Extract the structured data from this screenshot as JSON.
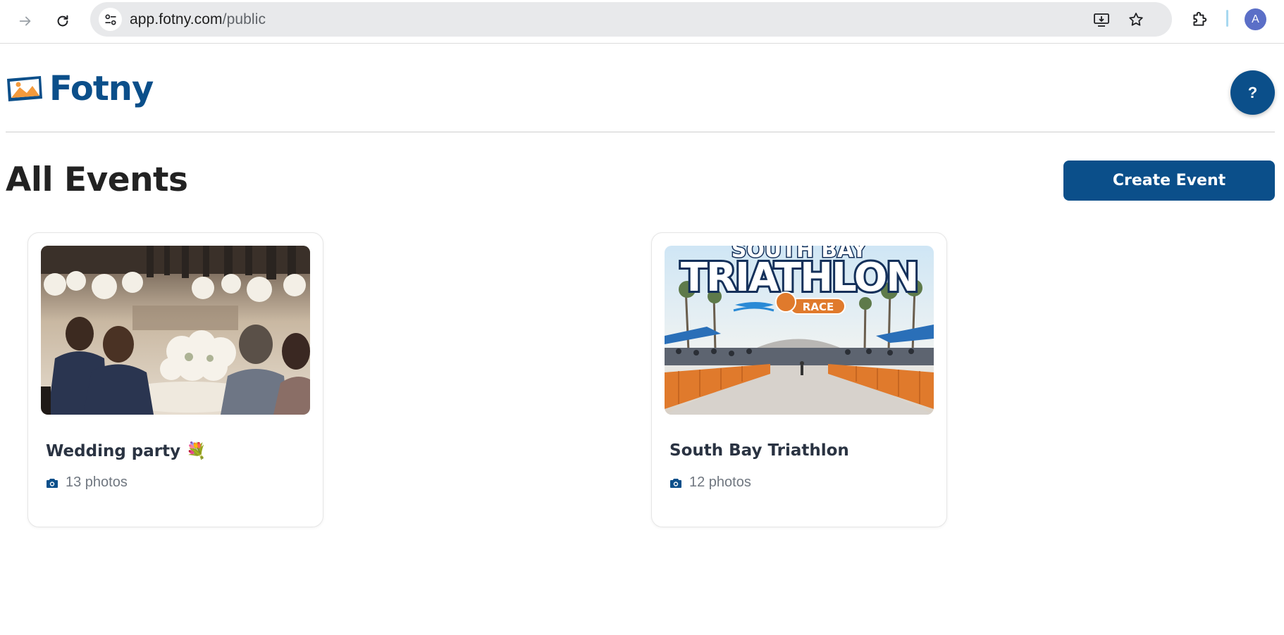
{
  "browser": {
    "url_host": "app.fotny.com",
    "url_path": "/public",
    "profile_initial": "A"
  },
  "header": {
    "logo_text": "Fotny",
    "help_label": "?"
  },
  "page": {
    "title": "All Events",
    "create_button_label": "Create Event"
  },
  "events": [
    {
      "title": "Wedding party",
      "emoji": "💐",
      "photo_count": "13 photos",
      "image": "wedding-photo"
    },
    {
      "title": "South Bay Triathlon",
      "photo_count": "12 photos",
      "image": "triathlon-banner",
      "banner_text": {
        "top": "SOUTH BAY",
        "main": "TRIATHLON",
        "badge": "RACE"
      }
    }
  ],
  "colors": {
    "brand": "#0b4f8a",
    "logo_orange": "#f39a3c",
    "text_dark": "#222222",
    "muted": "#707780"
  }
}
